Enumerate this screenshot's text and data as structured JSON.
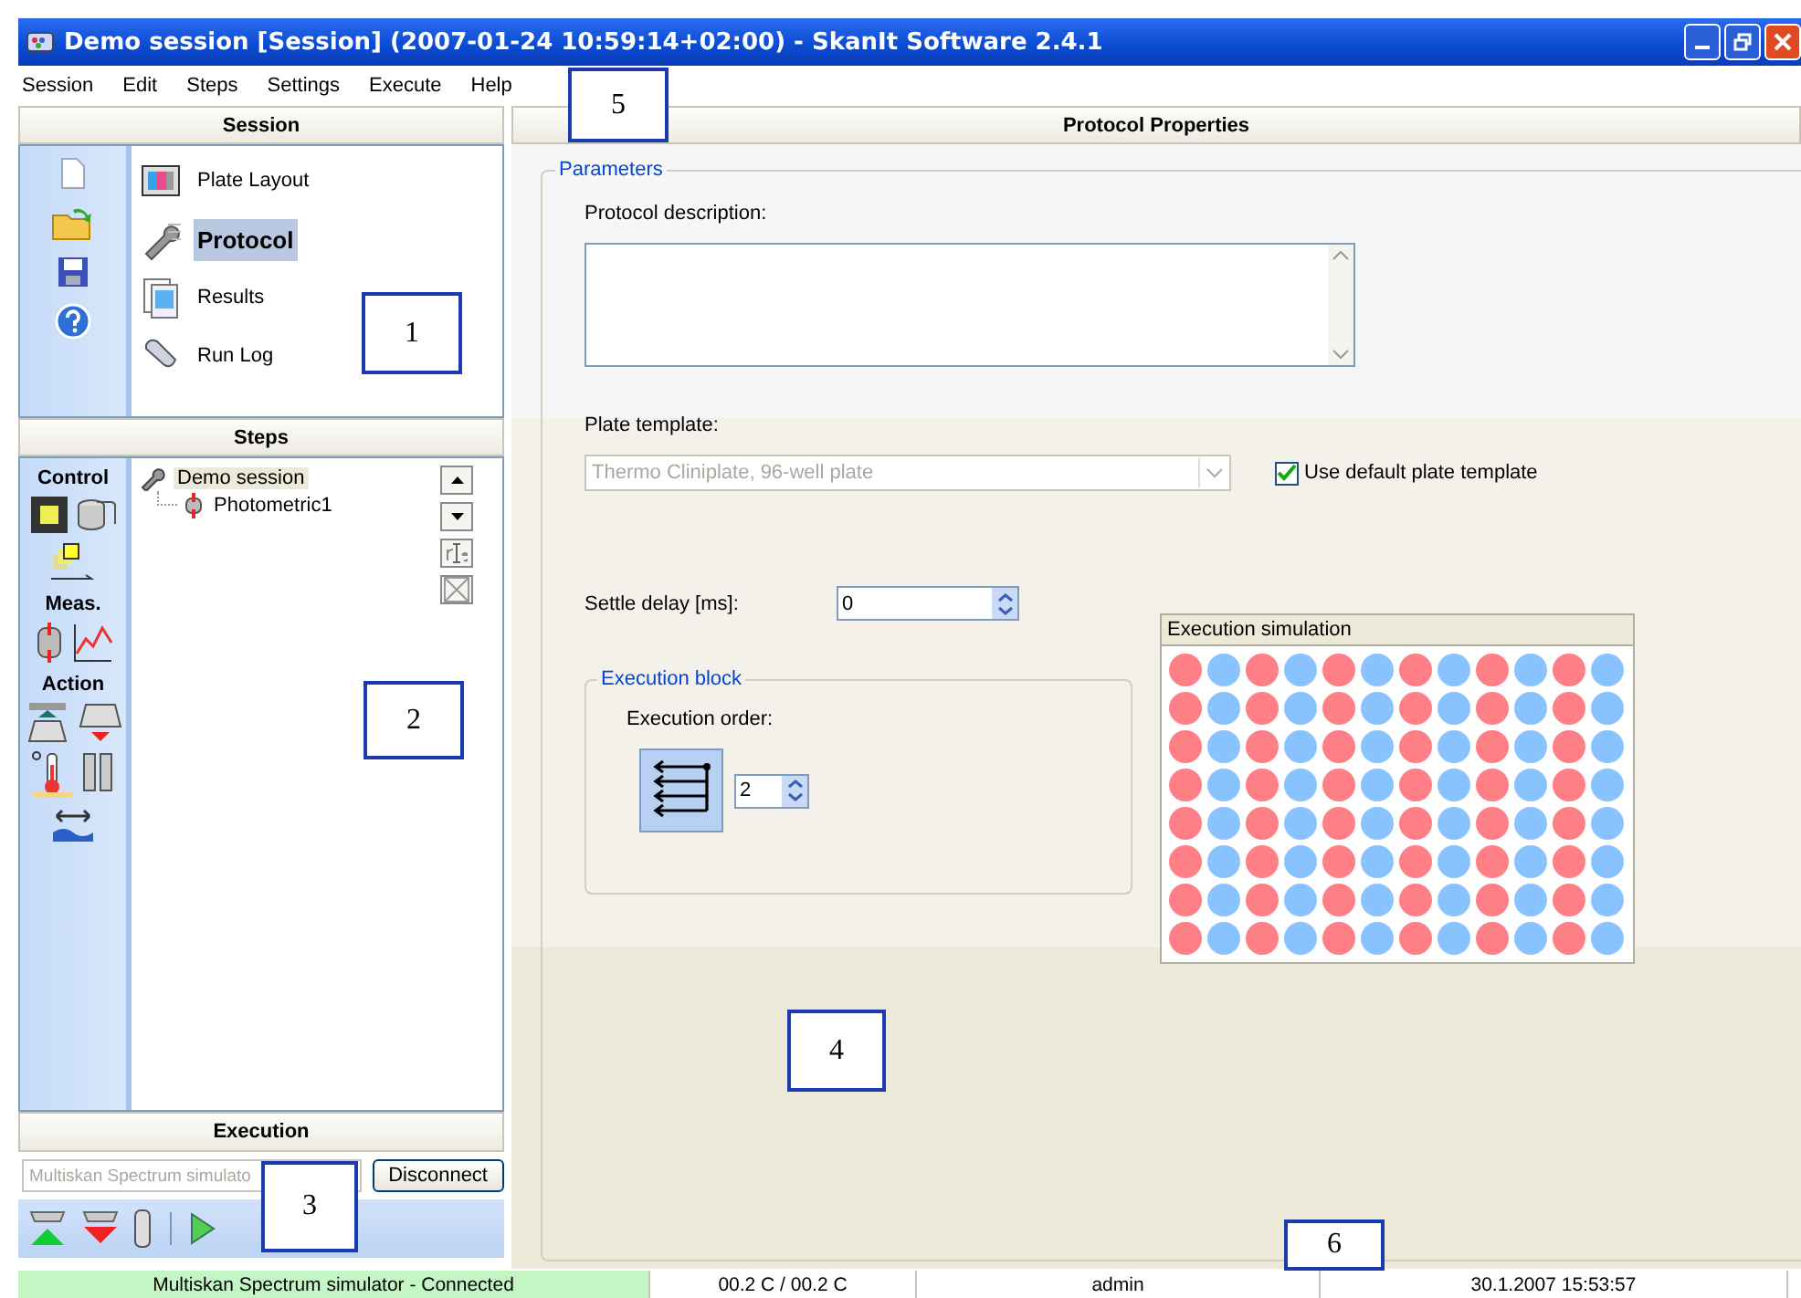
{
  "window": {
    "title": "Demo session [Session] (2007-01-24 10:59:14+02:00) - SkanIt Software 2.4.1"
  },
  "menu": [
    "Session",
    "Edit",
    "Steps",
    "Settings",
    "Execute",
    "Help"
  ],
  "session_panel": {
    "title": "Session",
    "items": [
      {
        "label": "Plate Layout",
        "selected": false
      },
      {
        "label": "Protocol",
        "selected": true
      },
      {
        "label": "Results",
        "selected": false
      },
      {
        "label": "Run Log",
        "selected": false
      }
    ]
  },
  "steps_panel": {
    "title": "Steps",
    "palette_sections": [
      "Control",
      "Meas.",
      "Action"
    ],
    "tree": [
      {
        "label": "Demo session",
        "selected": true,
        "children": [
          {
            "label": "Photometric1",
            "selected": false
          }
        ]
      }
    ]
  },
  "execution_panel": {
    "title": "Execution",
    "instrument": "Multiskan Spectrum simulato",
    "button": "Disconnect"
  },
  "properties": {
    "title": "Protocol Properties",
    "group": "Parameters",
    "description_label": "Protocol description:",
    "plate_template_label": "Plate template:",
    "plate_template": "Thermo Cliniplate, 96-well plate",
    "plate_template_disabled": true,
    "use_default": {
      "label": "Use default plate template",
      "checked": true
    },
    "settle_delay_label": "Settle delay [ms]:",
    "settle_delay": "0",
    "execution_block": {
      "title": "Execution block",
      "order_label": "Execution order:",
      "order": "2"
    },
    "simulation": {
      "title": "Execution simulation",
      "wells": [
        [
          {
            "color": "#ff7f86"
          },
          {
            "color": "#88c2ff"
          },
          {
            "color": "#ff7f86"
          },
          {
            "color": "#88c2ff"
          },
          {
            "color": "#ff7f86"
          },
          {
            "color": "#88c2ff"
          },
          {
            "color": "#ff7f86"
          },
          {
            "color": "#88c2ff"
          },
          {
            "color": "#ff7f86"
          },
          {
            "color": "#88c2ff"
          },
          {
            "color": "#ff7f86"
          },
          {
            "color": "#88c2ff"
          }
        ],
        [
          {
            "color": "#ff7f86"
          },
          {
            "color": "#88c2ff"
          },
          {
            "color": "#ff7f86"
          },
          {
            "color": "#88c2ff"
          },
          {
            "color": "#ff7f86"
          },
          {
            "color": "#88c2ff"
          },
          {
            "color": "#ff7f86"
          },
          {
            "color": "#88c2ff"
          },
          {
            "color": "#ff7f86"
          },
          {
            "color": "#88c2ff"
          },
          {
            "color": "#ff7f86"
          },
          {
            "color": "#88c2ff"
          }
        ],
        [
          {
            "color": "#ff7f86"
          },
          {
            "color": "#88c2ff"
          },
          {
            "color": "#ff7f86"
          },
          {
            "color": "#88c2ff"
          },
          {
            "color": "#ff7f86"
          },
          {
            "color": "#88c2ff"
          },
          {
            "color": "#ff7f86"
          },
          {
            "color": "#88c2ff"
          },
          {
            "color": "#ff7f86"
          },
          {
            "color": "#88c2ff"
          },
          {
            "color": "#ff7f86"
          },
          {
            "color": "#88c2ff"
          }
        ],
        [
          {
            "color": "#ff7f86"
          },
          {
            "color": "#88c2ff"
          },
          {
            "color": "#ff7f86"
          },
          {
            "color": "#88c2ff"
          },
          {
            "color": "#ff7f86"
          },
          {
            "color": "#88c2ff"
          },
          {
            "color": "#ff7f86"
          },
          {
            "color": "#88c2ff"
          },
          {
            "color": "#ff7f86"
          },
          {
            "color": "#88c2ff"
          },
          {
            "color": "#ff7f86"
          },
          {
            "color": "#88c2ff"
          }
        ],
        [
          {
            "color": "#ff7f86"
          },
          {
            "color": "#88c2ff"
          },
          {
            "color": "#ff7f86"
          },
          {
            "color": "#88c2ff"
          },
          {
            "color": "#ff7f86"
          },
          {
            "color": "#88c2ff"
          },
          {
            "color": "#ff7f86"
          },
          {
            "color": "#88c2ff"
          },
          {
            "color": "#ff7f86"
          },
          {
            "color": "#88c2ff"
          },
          {
            "color": "#ff7f86"
          },
          {
            "color": "#88c2ff"
          }
        ],
        [
          {
            "color": "#ff7f86"
          },
          {
            "color": "#88c2ff"
          },
          {
            "color": "#ff7f86"
          },
          {
            "color": "#88c2ff"
          },
          {
            "color": "#ff7f86"
          },
          {
            "color": "#88c2ff"
          },
          {
            "color": "#ff7f86"
          },
          {
            "color": "#88c2ff"
          },
          {
            "color": "#ff7f86"
          },
          {
            "color": "#88c2ff"
          },
          {
            "color": "#ff7f86"
          },
          {
            "color": "#88c2ff"
          }
        ],
        [
          {
            "color": "#ff7f86"
          },
          {
            "color": "#88c2ff"
          },
          {
            "color": "#ff7f86"
          },
          {
            "color": "#88c2ff"
          },
          {
            "color": "#ff7f86"
          },
          {
            "color": "#88c2ff"
          },
          {
            "color": "#ff7f86"
          },
          {
            "color": "#88c2ff"
          },
          {
            "color": "#ff7f86"
          },
          {
            "color": "#88c2ff"
          },
          {
            "color": "#ff7f86"
          },
          {
            "color": "#88c2ff"
          }
        ],
        [
          {
            "color": "#ff7f86"
          },
          {
            "color": "#88c2ff"
          },
          {
            "color": "#ff7f86"
          },
          {
            "color": "#88c2ff"
          },
          {
            "color": "#ff7f86"
          },
          {
            "color": "#88c2ff"
          },
          {
            "color": "#ff7f86"
          },
          {
            "color": "#88c2ff"
          },
          {
            "color": "#ff7f86"
          },
          {
            "color": "#88c2ff"
          },
          {
            "color": "#ff7f86"
          },
          {
            "color": "#88c2ff"
          }
        ]
      ]
    }
  },
  "status_bar": [
    {
      "kind": "connection",
      "text": "Multiskan Spectrum simulator - Connected"
    },
    {
      "kind": "plain",
      "text": "00.2 C / 00.2 C"
    },
    {
      "kind": "plain",
      "text": "admin"
    },
    {
      "kind": "plain",
      "text": "30.1.2007 15:53:57"
    }
  ],
  "callouts": [
    "1",
    "2",
    "3",
    "4",
    "5",
    "6"
  ]
}
